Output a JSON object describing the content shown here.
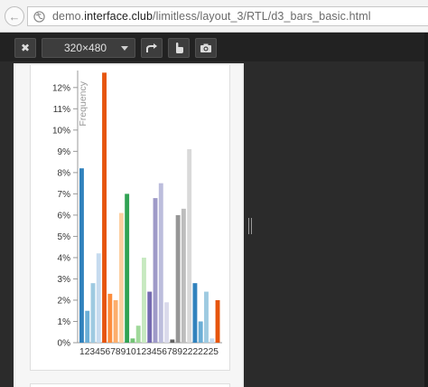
{
  "browser": {
    "url_prefix": "demo.",
    "url_domain": "interface.club",
    "url_path": "/limitless/layout_3/RTL/d3_bars_basic.html"
  },
  "toolbar": {
    "close_label": "✖",
    "size_value": "320×480",
    "rotate_icon": "rotate-icon",
    "touch_icon": "touch-icon",
    "screenshot_icon": "camera-icon"
  },
  "chart_data": {
    "type": "bar",
    "ylabel": "Frequency",
    "ylim": [
      0,
      12.8
    ],
    "y_ticks": [
      "0%",
      "1%",
      "2%",
      "3%",
      "4%",
      "5%",
      "6%",
      "7%",
      "8%",
      "9%",
      "10%",
      "11%",
      "12%"
    ],
    "x_tick_text": "123456789101234567892222225",
    "categories": [
      "1",
      "2",
      "3",
      "4",
      "5",
      "6",
      "7",
      "8",
      "9",
      "10",
      "11",
      "12",
      "13",
      "14",
      "15",
      "16",
      "17",
      "18",
      "19",
      "20",
      "21",
      "22",
      "23",
      "24",
      "25",
      "26"
    ],
    "values": [
      8.2,
      1.5,
      2.8,
      4.2,
      12.7,
      2.3,
      2.0,
      6.1,
      7.0,
      0.2,
      0.8,
      4.0,
      2.4,
      6.8,
      7.5,
      1.9,
      0.15,
      6.0,
      6.3,
      9.1,
      2.8,
      1.0,
      2.4,
      0.2,
      2.0
    ],
    "colors": [
      "#3182bd",
      "#6baed6",
      "#9ecae1",
      "#c6dbef",
      "#e6550d",
      "#fd8d3c",
      "#fdae6b",
      "#fdd0a2",
      "#31a354",
      "#74c476",
      "#a1d99b",
      "#c7e9c0",
      "#756bb1",
      "#9e9ac8",
      "#bcbddc",
      "#dadaeb",
      "#636363",
      "#969696",
      "#bdbdbd",
      "#d9d9d9",
      "#3182bd",
      "#6baed6",
      "#9ecae1",
      "#c6dbef",
      "#e6550d"
    ],
    "grid": false
  }
}
